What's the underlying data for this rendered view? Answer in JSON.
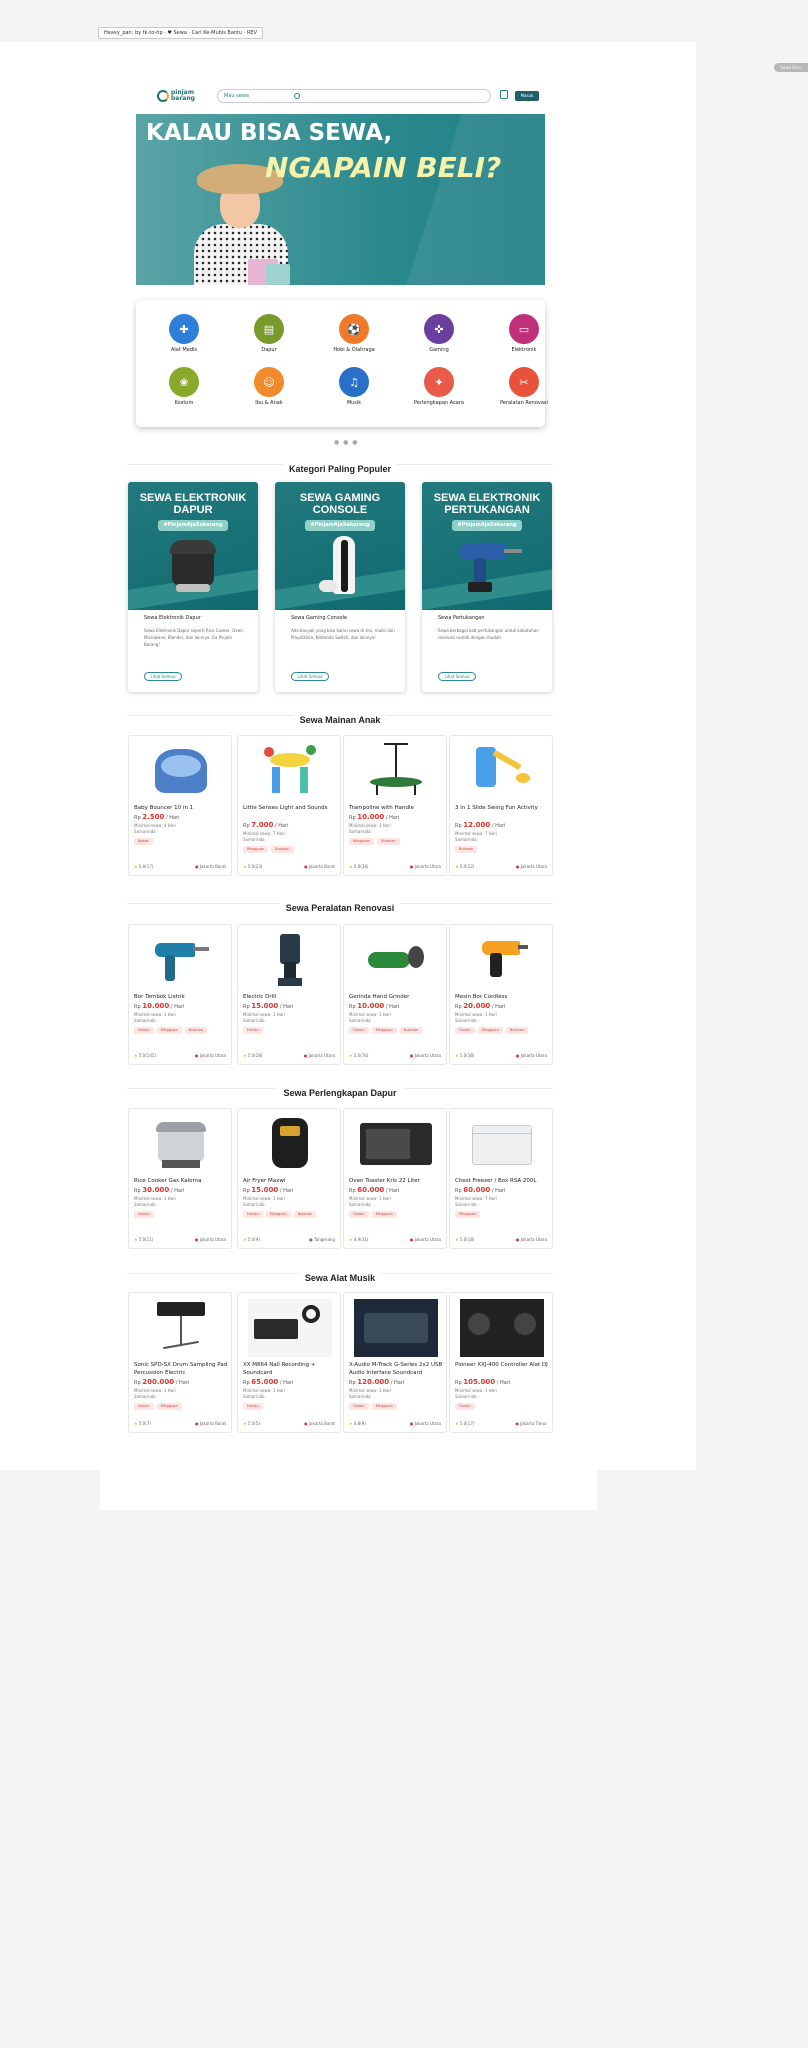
{
  "browser": {
    "address_note": "Heavy_pan: by tk-to-hp · ♥ Sewa · Cari Ke-Mubis Bantu · REV"
  },
  "side_tab": "Sewa Baru",
  "header": {
    "logo_text": "pinjam\nbarang",
    "search_placeholder": "Mau sewa",
    "login_label": "Masuk"
  },
  "hero": {
    "line1": "KALAU BISA SEWA,",
    "line2": "NGAPAIN BELI?"
  },
  "categories": [
    {
      "label": "Alat Medis",
      "color": "#2f7ed8",
      "icon": "stethoscope-icon",
      "glyph": "✚"
    },
    {
      "label": "Dapur",
      "color": "#7a9a2c",
      "icon": "fridge-icon",
      "glyph": "▤"
    },
    {
      "label": "Hobi & Olahraga",
      "color": "#f07a2a",
      "icon": "ball-icon",
      "glyph": "⚽"
    },
    {
      "label": "Gaming",
      "color": "#6b3fa0",
      "icon": "gamepad-icon",
      "glyph": "✜"
    },
    {
      "label": "Elektronik",
      "color": "#c0307a",
      "icon": "monitor-icon",
      "glyph": "▭"
    },
    {
      "label": "Kostum",
      "color": "#8aa82a",
      "icon": "costume-icon",
      "glyph": "❀"
    },
    {
      "label": "Ibu & Anak",
      "color": "#f08a2a",
      "icon": "baby-icon",
      "glyph": "☺"
    },
    {
      "label": "Musik",
      "color": "#2a6fc8",
      "icon": "headphones-icon",
      "glyph": "♫"
    },
    {
      "label": "Perlengkapan Acara",
      "color": "#e85a4a",
      "icon": "party-icon",
      "glyph": "✦"
    },
    {
      "label": "Peralatan Renovasi",
      "color": "#e8523a",
      "icon": "tools-icon",
      "glyph": "✂"
    }
  ],
  "carousel_dots": "● ● ●",
  "sections": {
    "popular": "Kategori Paling Populer",
    "toys": "Sewa Mainan Anak",
    "renovation": "Sewa Peralatan Renovasi",
    "kitchen": "Sewa Perlengkapan Dapur",
    "music": "Sewa Alat Musik"
  },
  "popular_cards": [
    {
      "headline": "SEWA ELEKTRONIK DAPUR",
      "tag": "#PinjamAjaSekarang",
      "name": "Sewa Elektronik Dapur",
      "desc": "Sewa Elektronik Dapur seperti Rice Cooker, Oven, Microwave, Blender, dan lainnya. Ga Pinjam Barang!",
      "button": "Lihat Semua"
    },
    {
      "headline": "SEWA GAMING CONSOLE",
      "tag": "#PinjamAjaSekarang",
      "name": "Sewa Gaming Console",
      "desc": "Ada banyak yang bisa kamu sewa di sini, mulai dari Playstation, Nintendo Switch, dan lainnya!",
      "button": "Lihat Semua"
    },
    {
      "headline": "SEWA ELEKTRONIK PERTUKANGAN",
      "tag": "#PinjamAjaSekarang",
      "name": "Sewa Pertukangan",
      "desc": "Sewa berbagai alat pertukangan untuk kebutuhan renovasi rumah dengan mudah.",
      "button": "Lihat Semua"
    }
  ],
  "toys": [
    {
      "name": "Baby Bouncer 10 in 1",
      "price": "2.500",
      "unit": "/ Hari",
      "deposit": "Minimal sewa: 4 Hari",
      "delivery": "Samarinda",
      "tags": [
        "Bekas"
      ],
      "rating": "5.0(17)",
      "location": "Jakarta Barat"
    },
    {
      "name": "Little Senses Light and Sounds",
      "price": "7.000",
      "unit": "/ Hari",
      "deposit": "Minimal sewa: 7 Hari",
      "delivery": "Samarinda",
      "tags": [
        "Mingguan",
        "Bulanan"
      ],
      "rating": "5.0(23)",
      "location": "Jakarta Barat"
    },
    {
      "name": "Trampoline with Handle",
      "price": "10.000",
      "unit": "/ Hari",
      "deposit": "Minimal sewa: 3 Hari",
      "delivery": "Samarinda",
      "tags": [
        "Mingguan",
        "Bulanan"
      ],
      "rating": "5.0(34)",
      "location": "Jakarta Utara"
    },
    {
      "name": "3 in 1 Slide Swing Fun Activity",
      "price": "12.000",
      "unit": "/ Hari",
      "deposit": "Minimal sewa: 7 Hari",
      "delivery": "Samarinda",
      "tags": [
        "Bulanan"
      ],
      "rating": "5.0(12)",
      "location": "Jakarta Utara"
    }
  ],
  "renovation": [
    {
      "name": "Bor Tembok Listrik",
      "price": "10.000",
      "unit": "/ Hari",
      "deposit": "Minimal sewa: 1 Hari",
      "delivery": "Samarinda",
      "tags": [
        "Harian",
        "Mingguan",
        "Bulanan"
      ],
      "rating": "5.0(145)",
      "location": "Jakarta Utara"
    },
    {
      "name": "Electric Drill",
      "price": "15.000",
      "unit": "/ Hari",
      "deposit": "Minimal sewa: 1 Hari",
      "delivery": "Samarinda",
      "tags": [
        "Harian"
      ],
      "rating": "5.0(28)",
      "location": "Jakarta Utara"
    },
    {
      "name": "Gerinda Hand Grinder",
      "price": "10.000",
      "unit": "/ Hari",
      "deposit": "Minimal sewa: 1 Hari",
      "delivery": "Samarinda",
      "tags": [
        "Harian",
        "Mingguan",
        "Bulanan"
      ],
      "rating": "5.0(76)",
      "location": "Jakarta Utara"
    },
    {
      "name": "Mesin Bor Cordless",
      "price": "20.000",
      "unit": "/ Hari",
      "deposit": "Minimal sewa: 1 Hari",
      "delivery": "Samarinda",
      "tags": [
        "Harian",
        "Mingguan",
        "Bulanan"
      ],
      "rating": "5.0(38)",
      "location": "Jakarta Utara"
    }
  ],
  "kitchen": [
    {
      "name": "Rice Cooker Gas Kalorna",
      "price": "30.000",
      "unit": "/ Hari",
      "deposit": "Minimal sewa: 1 Hari",
      "delivery": "Samarinda",
      "tags": [
        "Harian"
      ],
      "rating": "5.0(11)",
      "location": "Jakarta Utara"
    },
    {
      "name": "Air Fryer Maxwi",
      "price": "15.000",
      "unit": "/ Hari",
      "deposit": "Minimal sewa: 1 Hari",
      "delivery": "Samarinda",
      "tags": [
        "Harian",
        "Mingguan",
        "Bulanan"
      ],
      "rating": "5.0(9)",
      "location": "Tangerang"
    },
    {
      "name": "Oven Toaster Kris 22 Liter",
      "price": "60.000",
      "unit": "/ Hari",
      "deposit": "Minimal sewa: 1 Hari",
      "delivery": "Samarinda",
      "tags": [
        "Harian",
        "Mingguan"
      ],
      "rating": "4.9(31)",
      "location": "Jakarta Utara"
    },
    {
      "name": "Chest Freezer / Box RSA 200L",
      "price": "60.000",
      "unit": "/ Hari",
      "deposit": "Minimal sewa: 7 Hari",
      "delivery": "Samarinda",
      "tags": [
        "Mingguan"
      ],
      "rating": "5.0(18)",
      "location": "Jakarta Utara"
    }
  ],
  "music": [
    {
      "name": "Sonic SPD-SX Drum Sampling Pad Percussion Electric",
      "price": "200.000",
      "unit": "/ Hari",
      "deposit": "Minimal sewa: 1 Hari",
      "delivery": "Samarinda",
      "tags": [
        "Harian",
        "Mingguan"
      ],
      "rating": "5.0(7)",
      "location": "Jakarta Barat"
    },
    {
      "name": "XX M864 Nall Recording + Soundcard",
      "price": "65.000",
      "unit": "/ Hari",
      "deposit": "Minimal sewa: 1 Hari",
      "delivery": "Samarinda",
      "tags": [
        "Harian"
      ],
      "rating": "5.0(5)",
      "location": "Jakarta Barat"
    },
    {
      "name": "X-Audio M-Track G-Series 2x2 USB Audio Interface Soundcard",
      "price": "120.000",
      "unit": "/ Hari",
      "deposit": "Minimal sewa: 1 Hari",
      "delivery": "Samarinda",
      "tags": [
        "Harian",
        "Mingguan"
      ],
      "rating": "4.8(9)",
      "location": "Jakarta Utara"
    },
    {
      "name": "Pioneer XXJ-400 Controller Alat DJ",
      "price": "105.000",
      "unit": "/ Hari",
      "deposit": "Minimal sewa: 1 Hari",
      "delivery": "Samarinda",
      "tags": [
        "Harian"
      ],
      "rating": "5.0(17)",
      "location": "Jakarta Timur"
    }
  ],
  "currency": "Rp"
}
